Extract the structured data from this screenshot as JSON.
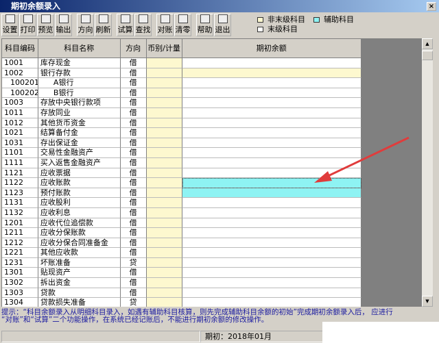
{
  "window": {
    "title": "期初余额录入",
    "close": "×"
  },
  "toolbar": [
    {
      "label": "设置",
      "icon": "settings-icon"
    },
    {
      "label": "打印",
      "icon": "print-icon"
    },
    {
      "label": "预览",
      "icon": "preview-icon"
    },
    {
      "label": "输出",
      "icon": "export-icon"
    },
    {
      "label": "方向",
      "icon": "direction-icon"
    },
    {
      "label": "刷新",
      "icon": "refresh-icon"
    },
    {
      "label": "试算",
      "icon": "trial-balance-icon"
    },
    {
      "label": "查找",
      "icon": "find-icon"
    },
    {
      "label": "对账",
      "icon": "reconcile-icon"
    },
    {
      "label": "清零",
      "icon": "clear-icon"
    },
    {
      "label": "帮助",
      "icon": "help-icon"
    },
    {
      "label": "退出",
      "icon": "exit-icon"
    }
  ],
  "legend": [
    {
      "label": "非末级科目",
      "color": "#fdf8cf"
    },
    {
      "label": "辅助科目",
      "color": "#8ef3f3"
    },
    {
      "label": "末级科目",
      "color": "#ffffff"
    }
  ],
  "columns": [
    "科目编码",
    "科目名称",
    "方向",
    "币别/计量",
    "期初余额"
  ],
  "rows": [
    [
      "1001",
      "库存现金",
      "借"
    ],
    [
      "1002",
      "银行存款",
      "借"
    ],
    [
      "100201",
      "A银行",
      "借"
    ],
    [
      "100202",
      "B银行",
      "借"
    ],
    [
      "1003",
      "存放中央银行款项",
      "借"
    ],
    [
      "1011",
      "存放同业",
      "借"
    ],
    [
      "1012",
      "其他货币资金",
      "借"
    ],
    [
      "1021",
      "结算备付金",
      "借"
    ],
    [
      "1031",
      "存出保证金",
      "借"
    ],
    [
      "1101",
      "交易性金融资产",
      "借"
    ],
    [
      "1111",
      "买入返售金融资产",
      "借"
    ],
    [
      "1121",
      "应收票据",
      "借"
    ],
    [
      "1122",
      "应收账款",
      "借"
    ],
    [
      "1123",
      "预付账款",
      "借"
    ],
    [
      "1131",
      "应收股利",
      "借"
    ],
    [
      "1132",
      "应收利息",
      "借"
    ],
    [
      "1201",
      "应收代位追偿款",
      "借"
    ],
    [
      "1211",
      "应收分保账款",
      "借"
    ],
    [
      "1212",
      "应收分保合同准备金",
      "借"
    ],
    [
      "1221",
      "其他应收款",
      "借"
    ],
    [
      "1231",
      "坏账准备",
      "贷"
    ],
    [
      "1301",
      "贴现资产",
      "借"
    ],
    [
      "1302",
      "拆出资金",
      "借"
    ],
    [
      "1303",
      "贷款",
      "借"
    ],
    [
      "1304",
      "贷款损失准备",
      "贷"
    ]
  ],
  "hint": {
    "line1": "提示：“科目余额录入从明细科目录入，如遇有辅助科目核算，则先完成辅助科目余额的初始”完成期初余额录入后，          应进行",
    "line2": "“对账”和“试算”二个功能操作，在系统已经记账后，不能进行期初余额的修改操作。"
  },
  "status": {
    "period": "期初：2018年01月"
  },
  "colors": {
    "selected": "#8ef3f3",
    "non_leaf": "#fdf8cf",
    "arrow": "#e03c3c"
  }
}
